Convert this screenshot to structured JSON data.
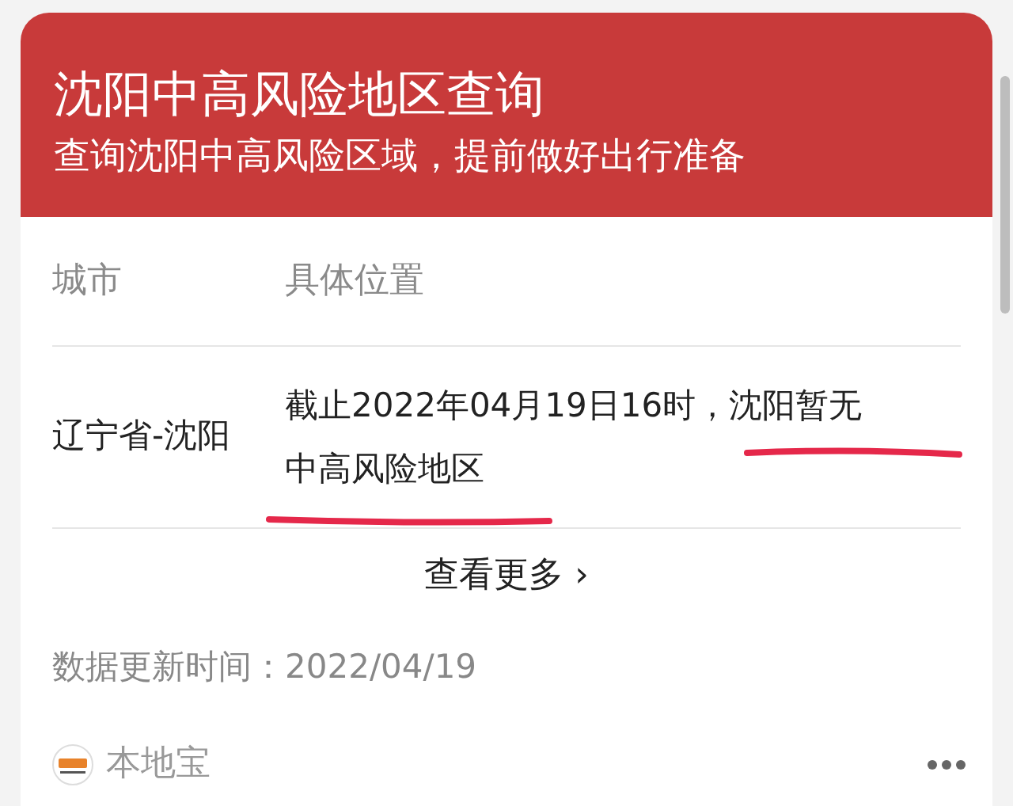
{
  "header": {
    "title": "沈阳中高风险地区查询",
    "subtitle": "查询沈阳中高风险区域，提前做好出行准备"
  },
  "table": {
    "columns": [
      "城市",
      "具体位置"
    ],
    "rows": [
      {
        "city": "辽宁省-沈阳",
        "location": "截止2022年04月19日16时，沈阳暂无中高风险地区"
      }
    ]
  },
  "more_link": {
    "label": "查看更多",
    "arrow": "›"
  },
  "update_time": "数据更新时间：2022/04/19",
  "footer": {
    "source": "本地宝"
  }
}
